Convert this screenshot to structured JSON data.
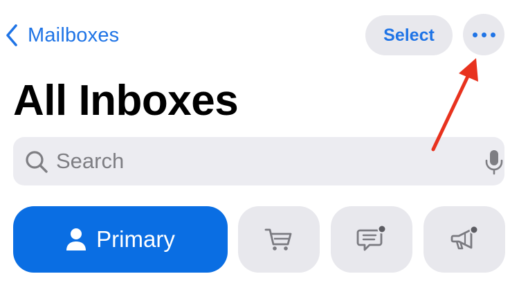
{
  "nav": {
    "back_label": "Mailboxes",
    "select_label": "Select",
    "more_icon": "ellipsis-icon"
  },
  "page": {
    "title": "All Inboxes"
  },
  "search": {
    "placeholder": "Search",
    "icon": "search-icon",
    "mic_icon": "microphone-icon"
  },
  "tabs": [
    {
      "label": "Primary",
      "icon": "person-icon",
      "selected": true
    },
    {
      "label": "",
      "icon": "cart-icon",
      "selected": false
    },
    {
      "label": "",
      "icon": "message-badge-icon",
      "selected": false
    },
    {
      "label": "",
      "icon": "megaphone-badge-icon",
      "selected": false
    }
  ],
  "annotation": {
    "type": "arrow",
    "color": "#e8321e"
  },
  "colors": {
    "accent": "#1f74e6",
    "primary_tab": "#0a6ee3",
    "pill_bg": "#e8e8ed",
    "search_bg": "#ececf1"
  }
}
